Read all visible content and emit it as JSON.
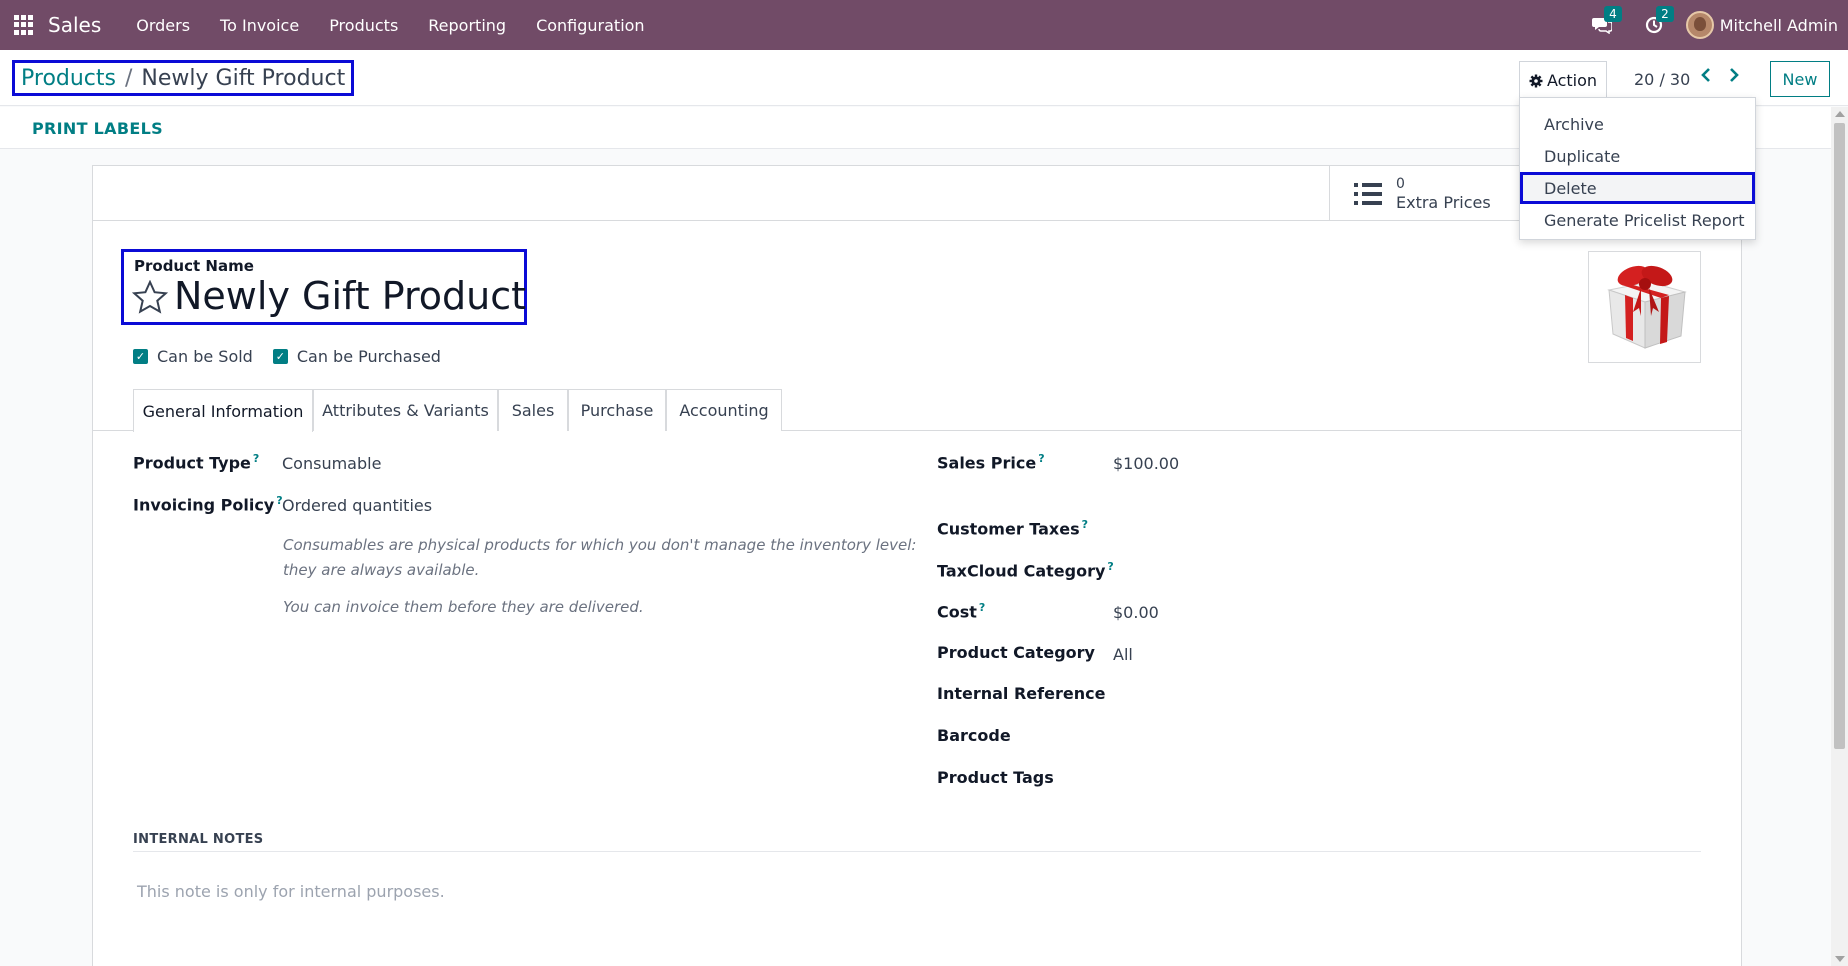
{
  "navbar": {
    "app_name": "Sales",
    "menu": [
      "Orders",
      "To Invoice",
      "Products",
      "Reporting",
      "Configuration"
    ],
    "messages_count": "4",
    "activities_count": "2",
    "user_name": "Mitchell Admin"
  },
  "control_panel": {
    "breadcrumb_parent": "Products",
    "breadcrumb_separator": "/",
    "breadcrumb_current": "Newly Gift Product",
    "action_label": "Action",
    "pager": "20 / 30",
    "new_label": "New"
  },
  "statusbar": {
    "print_labels": "PRINT LABELS"
  },
  "action_menu": [
    "Archive",
    "Duplicate",
    "Delete",
    "Generate Pricelist Report"
  ],
  "smart_button": {
    "value": "0",
    "label": "Extra Prices"
  },
  "form": {
    "name_label": "Product Name",
    "name": "Newly Gift Product",
    "can_be_sold": "Can be Sold",
    "can_be_purchased": "Can be Purchased",
    "tabs": [
      "General Information",
      "Attributes & Variants",
      "Sales",
      "Purchase",
      "Accounting"
    ],
    "left_fields": {
      "product_type_label": "Product Type",
      "product_type": "Consumable",
      "invoicing_policy_label": "Invoicing Policy",
      "invoicing_policy": "Ordered quantities",
      "help_1a": "Consumables are physical products for which you don't manage the inventory level:",
      "help_1b": "they are always available.",
      "help_2": "You can invoice them before they are delivered."
    },
    "right_fields": {
      "sales_price_label": "Sales Price",
      "sales_price": "$100.00",
      "customer_taxes_label": "Customer Taxes",
      "taxcloud_category_label": "TaxCloud Category",
      "cost_label": "Cost",
      "cost": "$0.00",
      "product_category_label": "Product Category",
      "product_category": "All",
      "internal_reference_label": "Internal Reference",
      "barcode_label": "Barcode",
      "product_tags_label": "Product Tags"
    },
    "help_marker": "?",
    "internal_notes_title": "INTERNAL NOTES",
    "internal_notes_placeholder": "This note is only for internal purposes."
  }
}
